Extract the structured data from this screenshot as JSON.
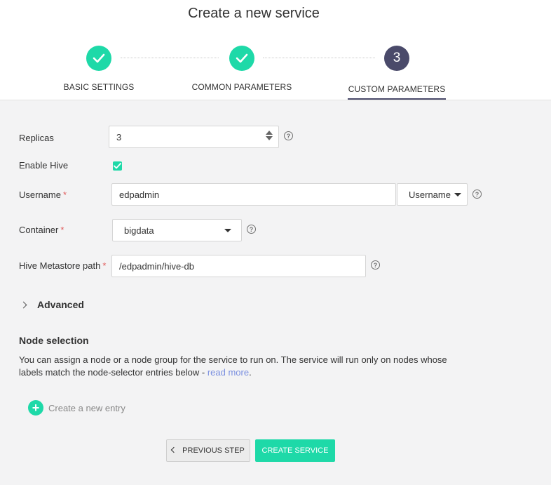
{
  "page": {
    "title": "Create a new service"
  },
  "steps": [
    {
      "label": "BASIC SETTINGS",
      "state": "done"
    },
    {
      "label": "COMMON PARAMETERS",
      "state": "done"
    },
    {
      "label": "CUSTOM PARAMETERS",
      "state": "current",
      "number": "3"
    }
  ],
  "form": {
    "replicas": {
      "label": "Replicas",
      "value": "3"
    },
    "enable_hive": {
      "label": "Enable Hive",
      "checked": true
    },
    "username": {
      "label": "Username",
      "required_mark": "*",
      "value": "edpadmin",
      "type_dropdown": "Username"
    },
    "container": {
      "label": "Container",
      "required_mark": "*",
      "value": "bigdata"
    },
    "metastore": {
      "label": "Hive Metastore path",
      "required_mark": "*",
      "value": "/edpadmin/hive-db"
    },
    "help_glyph": "?"
  },
  "advanced": {
    "label": "Advanced"
  },
  "node_selection": {
    "title": "Node selection",
    "description": "You can assign a node or a node group for the service to run on. The service will run only on nodes whose labels match the node-selector entries below - ",
    "link_text": "read more",
    "after_link": ".",
    "create_entry": "Create a new entry",
    "plus_glyph": "+"
  },
  "buttons": {
    "previous": "PREVIOUS STEP",
    "create": "CREATE SERVICE"
  },
  "colors": {
    "accent": "#1ed9a8",
    "current_step": "#4a4a6a",
    "link": "#7a8fe0",
    "required": "#e05c5c"
  }
}
